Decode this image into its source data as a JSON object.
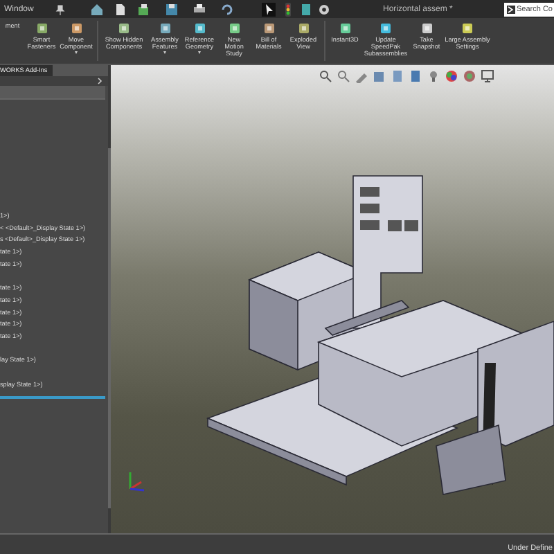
{
  "menu": {
    "item": "Window"
  },
  "window": {
    "title": "Horizontal assem *"
  },
  "search": {
    "placeholder": "Search Co"
  },
  "ribbon": [
    {
      "label": "ment",
      "dropdown": false
    },
    {
      "label": "Smart Fasteners",
      "dropdown": false
    },
    {
      "label": "Move Component",
      "dropdown": true
    },
    {
      "label": "Show Hidden Components",
      "dropdown": false
    },
    {
      "label": "Assembly Features",
      "dropdown": true
    },
    {
      "label": "Reference Geometry",
      "dropdown": true
    },
    {
      "label": "New Motion Study",
      "dropdown": false
    },
    {
      "label": "Bill of Materials",
      "dropdown": false
    },
    {
      "label": "Exploded View",
      "dropdown": false
    },
    {
      "label": "Instant3D",
      "dropdown": false
    },
    {
      "label": "Update SpeedPak Subassemblies",
      "dropdown": false
    },
    {
      "label": "Take Snapshot",
      "dropdown": false
    },
    {
      "label": "Large Assembly Settings",
      "dropdown": false
    }
  ],
  "tabs": [
    {
      "label": "WORKS Add-Ins",
      "selected": true
    }
  ],
  "tree_groups": [
    {
      "items": [
        "1>)",
        "< <Default>_Display State 1>)",
        "s <Default>_Display State 1>)",
        "tate 1>)",
        "tate 1>)"
      ]
    },
    {
      "items": [
        "tate 1>)",
        "tate 1>)",
        "tate 1>)",
        "tate 1>)",
        "tate 1>)"
      ]
    },
    {
      "items": [
        "lay State 1>)"
      ]
    },
    {
      "items": [
        "splay State 1>)"
      ]
    }
  ],
  "status_bar": {
    "text": "Under Define"
  }
}
